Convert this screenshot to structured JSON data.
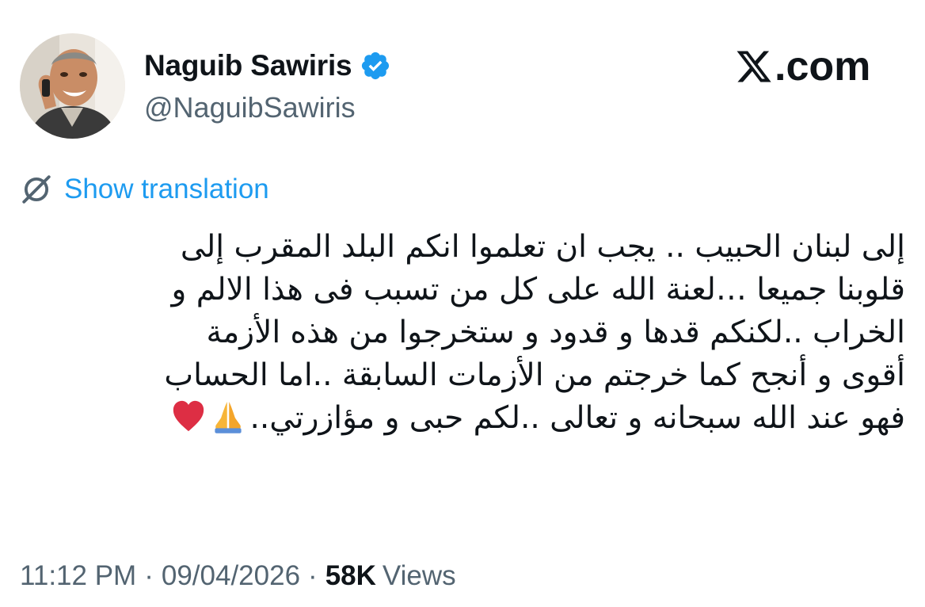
{
  "author": {
    "name": "Naguib Sawiris",
    "handle": "@NaguibSawiris",
    "verified": true,
    "avatar_icon": "profile-photo"
  },
  "site": {
    "label": ".com",
    "logo_icon": "x-logo-icon"
  },
  "translation": {
    "label": "Show translation",
    "icon": "translate-icon"
  },
  "tweet": {
    "lines": [
      "إلى لبنان الحبيب .. يجب ان تعلموا انكم البلد المقرب إلى",
      "قلوبنا جميعا …لعنة الله على كل من تسبب فى هذا الالم و",
      "الخراب ..لكنكم قدها و قدود و ستخرجوا من هذه الأزمة",
      "أقوى و أنجح كما خرجتم من الأزمات السابقة ..اما الحساب",
      "فهو عند الله سبحانه و تعالى ..لكم حبى و مؤازرتي.."
    ],
    "emojis": [
      "folded-hands-icon",
      "red-heart-icon"
    ]
  },
  "meta": {
    "time": "11:12 PM",
    "date": "09/04/2026",
    "separator": "·",
    "views_count": "58K",
    "views_label": "Views"
  },
  "colors": {
    "link": "#1d9bf0",
    "secondary": "#536471",
    "primary": "#0f1419",
    "verified": "#1d9bf0"
  }
}
